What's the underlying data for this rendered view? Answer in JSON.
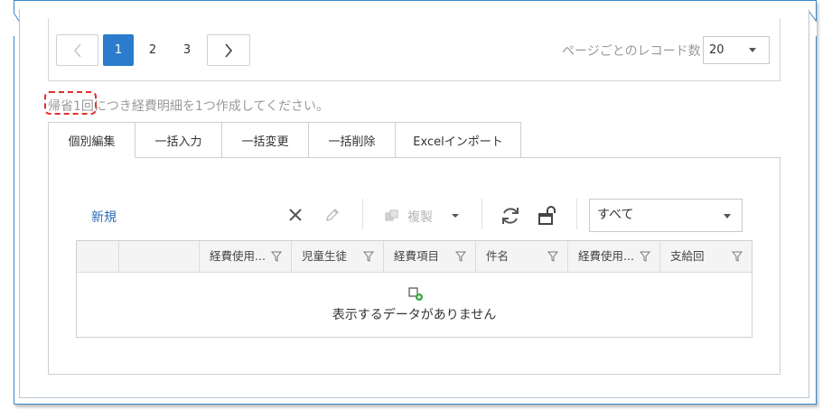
{
  "pager": {
    "pages": [
      "1",
      "2",
      "3"
    ],
    "current_page": "1",
    "records_label": "ページごとのレコード数",
    "page_size": "20"
  },
  "notice": {
    "text": "帰省1回につき経費明細を1つ作成してください。"
  },
  "tabs": [
    {
      "label": "個別編集",
      "active": true
    },
    {
      "label": "一括入力",
      "active": false
    },
    {
      "label": "一括変更",
      "active": false
    },
    {
      "label": "一括削除",
      "active": false
    },
    {
      "label": "Excelインポート",
      "active": false
    }
  ],
  "toolbar": {
    "new_label": "新規",
    "duplicate_label": "複製",
    "filter_value": "すべて",
    "icons": [
      "close-icon",
      "pencil-icon",
      "duplicate-icon",
      "chevron-down-icon",
      "refresh-icon",
      "unlock-icon"
    ]
  },
  "grid": {
    "columns": [
      "経費使用...",
      "児童生徒",
      "経費項目",
      "件名",
      "経費使用...",
      "支給回"
    ],
    "empty_text": "表示するデータがありません"
  },
  "colors": {
    "accent": "#2b7ccc",
    "link": "#2b6db5",
    "highlight": "#e0302d",
    "border_blue": "#3a86c8"
  }
}
